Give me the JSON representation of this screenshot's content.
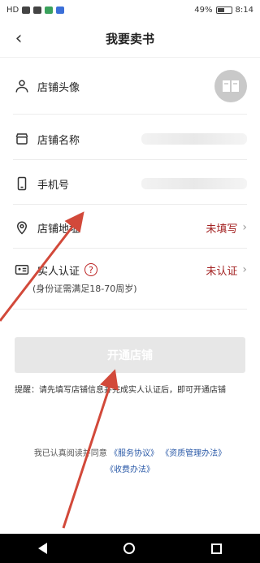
{
  "status_bar": {
    "left_text": "HD",
    "battery": "49%",
    "time": "8:14"
  },
  "nav": {
    "title": "我要卖书"
  },
  "rows": [
    {
      "label": "店铺头像"
    },
    {
      "label": "店铺名称"
    },
    {
      "label": "手机号"
    },
    {
      "label": "店铺地址",
      "status": "未填写"
    },
    {
      "label": "实人认证",
      "status": "未认证",
      "sub": "(身份证需满足18-70周岁)"
    }
  ],
  "cta": {
    "label": "开通店铺"
  },
  "tip": "提醒：请先填写店铺信息并完成实人认证后，即可开通店铺",
  "agreement": {
    "prefix": "我已认真阅读并同意",
    "link1": "《服务协议》",
    "link2": "《资质管理办法》",
    "link3": "《收费办法》"
  },
  "colors": {
    "status_red": "#a32121",
    "link_blue": "#2b5aa8",
    "arrow_red": "#d2493a"
  }
}
